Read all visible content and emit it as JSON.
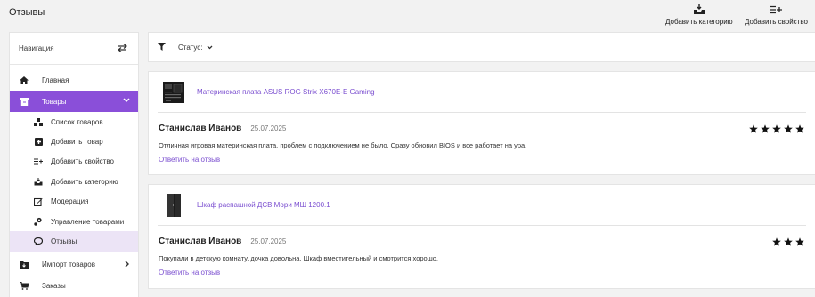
{
  "header": {
    "title": "Отзывы",
    "add_category_label": "Добавить категорию",
    "add_property_label": "Добавить свойство"
  },
  "sidebar": {
    "title": "Навигация",
    "items": [
      {
        "label": "Главная",
        "icon": "home-icon"
      },
      {
        "label": "Товары",
        "icon": "box-icon",
        "active": true
      },
      {
        "label": "Импорт товаров",
        "icon": "import-icon"
      },
      {
        "label": "Заказы",
        "icon": "cart-icon"
      }
    ],
    "sub_items": [
      {
        "label": "Список товаров",
        "icon": "list-icon"
      },
      {
        "label": "Добавить товар",
        "icon": "plus-square-icon"
      },
      {
        "label": "Добавить свойство",
        "icon": "add-property-icon"
      },
      {
        "label": "Добавить категорию",
        "icon": "add-category-icon"
      },
      {
        "label": "Модерация",
        "icon": "edit-icon"
      },
      {
        "label": "Управление товарами",
        "icon": "manage-icon"
      },
      {
        "label": "Отзывы",
        "icon": "reviews-icon",
        "selected": true
      }
    ]
  },
  "filter": {
    "status_label": "Статус:"
  },
  "reviews": [
    {
      "product": "Материнская плата ASUS ROG Strix X670E-E Gaming",
      "author": "Станислав Иванов",
      "date": "25.07.2025",
      "rating": 5,
      "text": "Отличная игровая материнская плата, проблем с подключением не было. Сразу обновил BIOS и все работает на ура.",
      "reply_label": "Ответить на отзыв"
    },
    {
      "product": "Шкаф распашной ДСВ Мори МШ 1200.1",
      "author": "Станислав Иванов",
      "date": "25.07.2025",
      "rating": 3,
      "text": "Покупали в детскую комнату, дочка довольна. Шкаф вместительный и смотрится хорошо.",
      "reply_label": "Ответить на отзыв"
    }
  ],
  "colors": {
    "accent": "#8a4fd9",
    "link": "#7b4fd0",
    "selected_bg": "#ece4f6"
  }
}
